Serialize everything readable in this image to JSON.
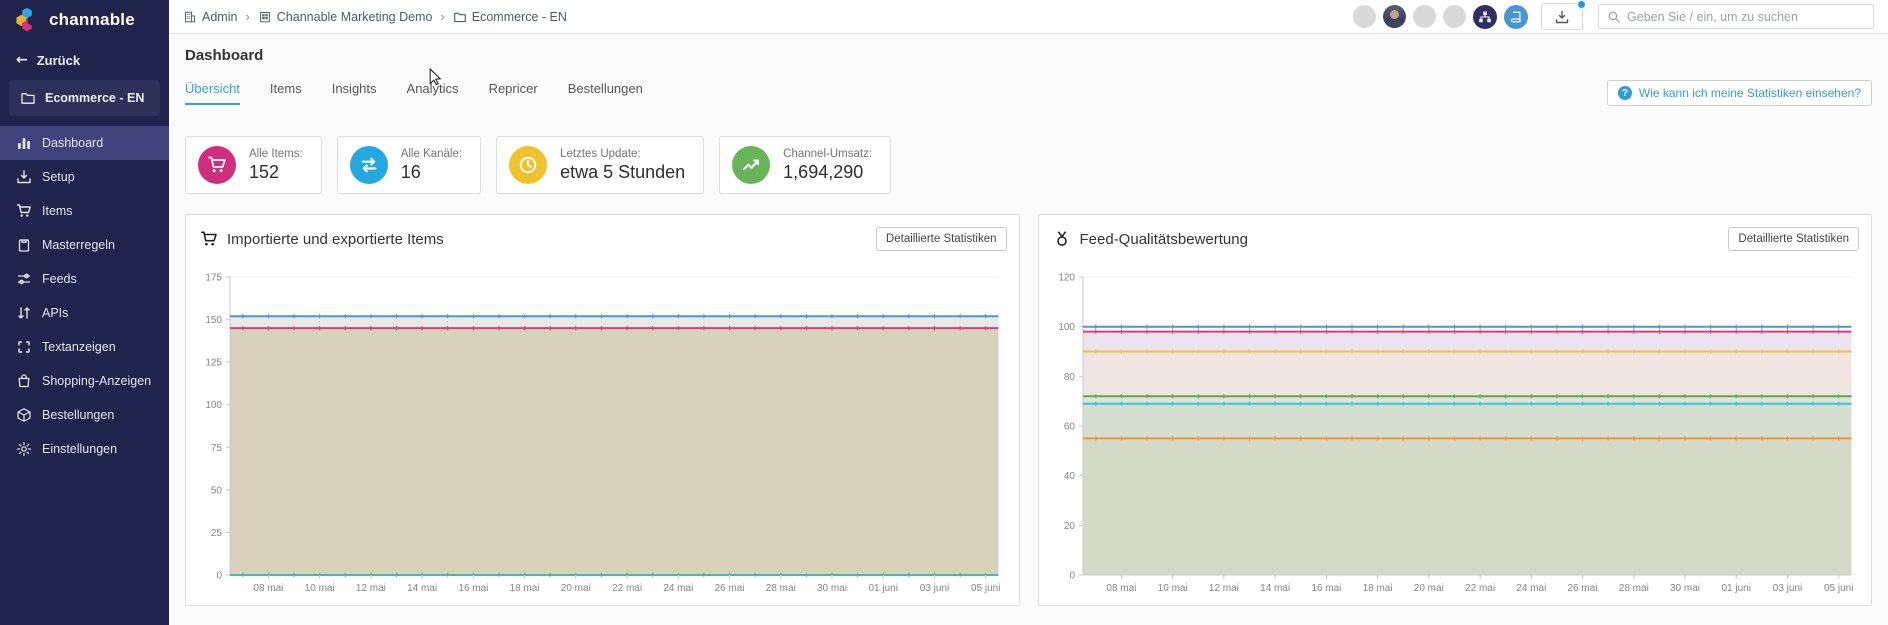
{
  "sidebar": {
    "logo_text": "channable",
    "back_label": "Zurück",
    "project_label": "Ecommerce - EN",
    "items": [
      {
        "label": "Dashboard",
        "icon": "bar-chart",
        "active": true
      },
      {
        "label": "Setup",
        "icon": "inbox-download",
        "active": false
      },
      {
        "label": "Items",
        "icon": "cart",
        "active": false
      },
      {
        "label": "Masterregeln",
        "icon": "clipboard",
        "active": false
      },
      {
        "label": "Feeds",
        "icon": "sliders",
        "active": false
      },
      {
        "label": "APIs",
        "icon": "arrows-updown",
        "active": false
      },
      {
        "label": "Textanzeigen",
        "icon": "brackets",
        "active": false
      },
      {
        "label": "Shopping-Anzeigen",
        "icon": "shopping-bag",
        "active": false
      },
      {
        "label": "Bestellungen",
        "icon": "package",
        "active": false
      },
      {
        "label": "Einstellungen",
        "icon": "gear",
        "active": false
      }
    ]
  },
  "topbar": {
    "breadcrumb": [
      {
        "label": "Admin",
        "icon": "building"
      },
      {
        "label": "Channable Marketing Demo",
        "icon": "company"
      },
      {
        "label": "Ecommerce - EN",
        "icon": "folder"
      }
    ],
    "avatars": [
      {
        "kind": "placeholder"
      },
      {
        "kind": "photo"
      },
      {
        "kind": "placeholder"
      },
      {
        "kind": "placeholder"
      }
    ],
    "icon_buttons": [
      {
        "icon": "sitemap",
        "bg": "#2c3064"
      },
      {
        "icon": "book",
        "bg": "#4a96d2"
      }
    ],
    "export_button": {
      "icon": "download-tray",
      "has_notification": true
    },
    "search_placeholder": "Geben Sie / ein, um zu suchen"
  },
  "page": {
    "title": "Dashboard",
    "tabs": [
      {
        "label": "Übersicht",
        "active": true
      },
      {
        "label": "Items",
        "active": false
      },
      {
        "label": "Insights",
        "active": false
      },
      {
        "label": "Analytics",
        "active": false
      },
      {
        "label": "Repricer",
        "active": false
      },
      {
        "label": "Bestellungen",
        "active": false
      }
    ],
    "help_button_label": "Wie kann ich meine Statistiken einsehen?"
  },
  "stats": [
    {
      "label": "Alle Items:",
      "value": "152",
      "icon": "cart",
      "color": "#cf2e7d"
    },
    {
      "label": "Alle Kanäle:",
      "value": "16",
      "icon": "swap",
      "color": "#25a8e0"
    },
    {
      "label": "Letztes Update:",
      "value": "etwa 5 Stunden",
      "icon": "clock",
      "color": "#eec32f"
    },
    {
      "label": "Channel-Umsatz:",
      "value": "1,694,290",
      "icon": "trend",
      "color": "#67b558"
    }
  ],
  "charts": [
    {
      "title": "Importierte und exportierte Items",
      "icon": "cart",
      "button_label": "Detaillierte Statistiken"
    },
    {
      "title": "Feed-Qualitätsbewertung",
      "icon": "medal",
      "button_label": "Detaillierte Statistiken"
    }
  ],
  "chart_data": [
    {
      "type": "area",
      "title": "Importierte und exportierte Items",
      "categories": [
        "08 mai",
        "10 mai",
        "12 mai",
        "14 mai",
        "16 mai",
        "18 mai",
        "20 mai",
        "22 mai",
        "24 mai",
        "26 mai",
        "28 mai",
        "30 mai",
        "01 juni",
        "03 juni",
        "05 juni"
      ],
      "xlabel": "",
      "ylabel": "",
      "ylim": [
        0,
        175
      ],
      "yticks": [
        0,
        25,
        50,
        75,
        100,
        125,
        150,
        175
      ],
      "grid": true,
      "legend": false,
      "series": [
        {
          "name": "series-1",
          "value": 152,
          "color": "#4d97cc",
          "band": "#e8eae7"
        },
        {
          "name": "series-2",
          "value": 145,
          "color": "#dc3d80",
          "band": "#d8d1bb"
        },
        {
          "name": "series-3",
          "value": 0,
          "color": "#4db9a9",
          "band": null
        }
      ]
    },
    {
      "type": "area",
      "title": "Feed-Qualitätsbewertung",
      "categories": [
        "08 mai",
        "10 mai",
        "12 mai",
        "14 mai",
        "16 mai",
        "18 mai",
        "20 mai",
        "22 mai",
        "24 mai",
        "26 mai",
        "28 mai",
        "30 mai",
        "01 juni",
        "03 juni",
        "05 juni"
      ],
      "xlabel": "",
      "ylabel": "",
      "ylim": [
        0,
        120
      ],
      "yticks": [
        0,
        20,
        40,
        60,
        80,
        100,
        120
      ],
      "grid": true,
      "legend": false,
      "series": [
        {
          "name": "series-1",
          "value": 100,
          "color": "#4d97cc",
          "band": null
        },
        {
          "name": "series-2",
          "value": 98,
          "color": "#dc3d80",
          "band": "#ebe3f0"
        },
        {
          "name": "series-3",
          "value": 90,
          "color": "#eec243",
          "band": "#f1e5e1"
        },
        {
          "name": "series-4",
          "value": 72,
          "color": "#61a64f",
          "band": "#dde6d8"
        },
        {
          "name": "series-5",
          "value": 69,
          "color": "#3fc0e0",
          "band": "#d4dfcf"
        },
        {
          "name": "series-6",
          "value": 55,
          "color": "#f0933c",
          "band": "#d5dac6"
        }
      ]
    }
  ]
}
